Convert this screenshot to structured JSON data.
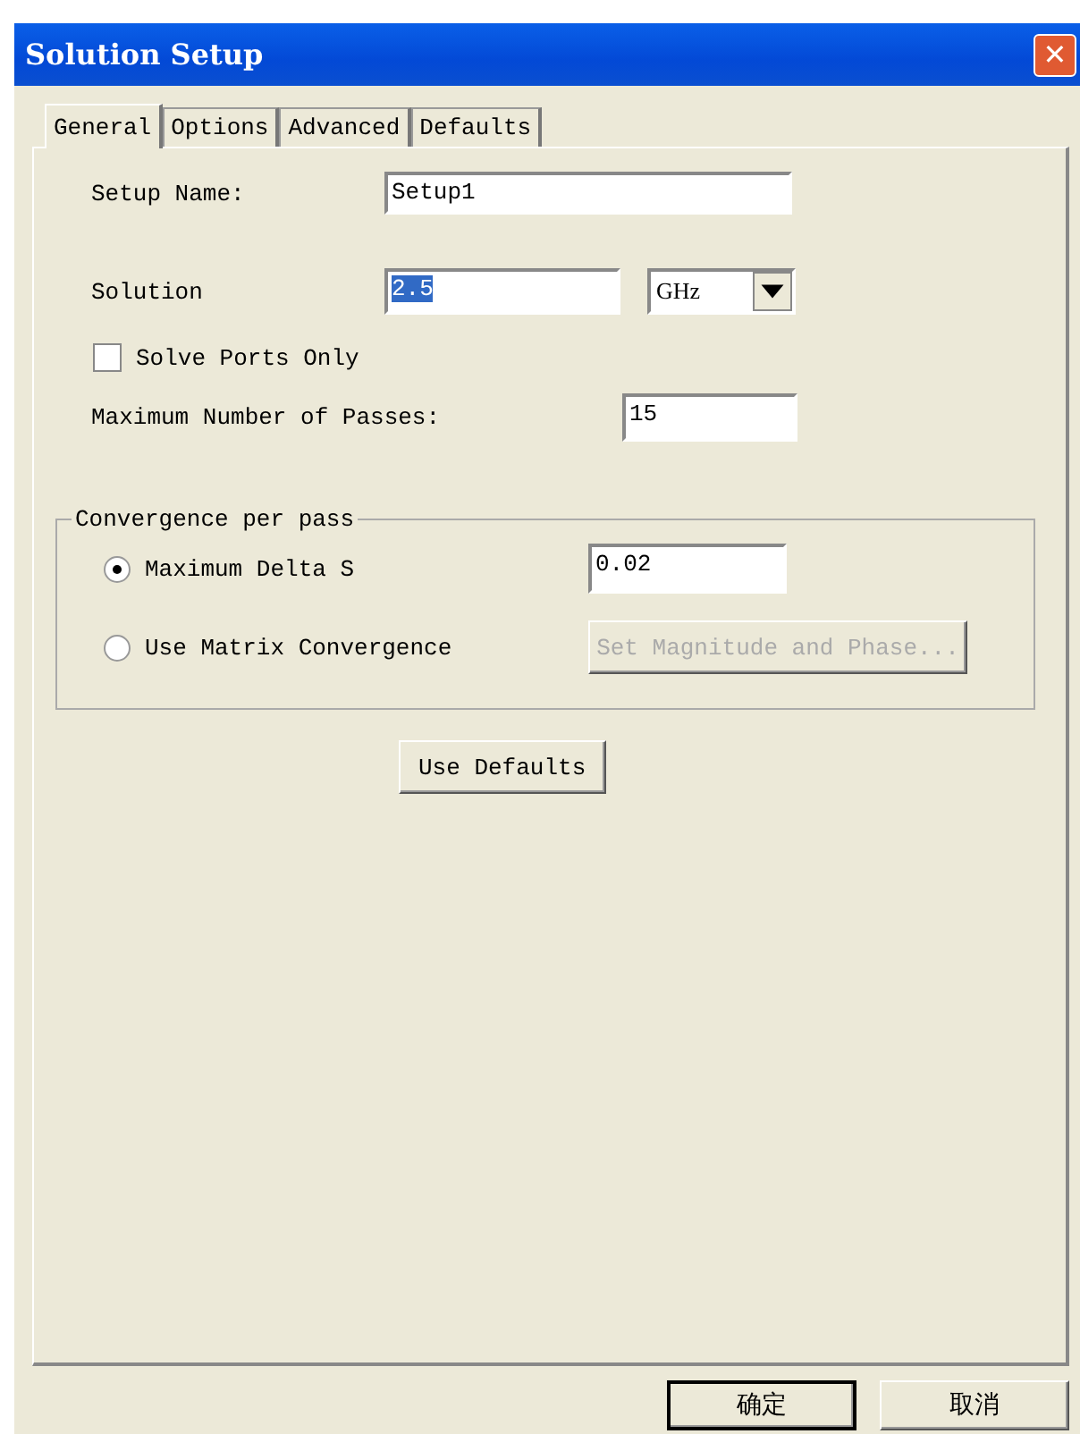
{
  "window": {
    "title": "Solution Setup",
    "close": "✕"
  },
  "tabs": [
    {
      "label": "General",
      "selected": true
    },
    {
      "label": "Options",
      "selected": false
    },
    {
      "label": "Advanced",
      "selected": false
    },
    {
      "label": "Defaults",
      "selected": false
    }
  ],
  "setup_name": {
    "label": "Setup Name:",
    "value": "Setup1"
  },
  "solution": {
    "label": "Solution",
    "value": "2.5",
    "value_selected": true,
    "unit": "GHz"
  },
  "solve_ports_only": {
    "label": "Solve Ports Only",
    "checked": false
  },
  "max_passes": {
    "label": "Maximum Number of Passes:",
    "value": "15"
  },
  "convergence": {
    "title": "Convergence per pass",
    "options": [
      {
        "label": "Maximum Delta S",
        "selected": true,
        "kind": "field",
        "value": "0.02"
      },
      {
        "label": "Use Matrix Convergence",
        "selected": false,
        "kind": "button",
        "button": "Set Magnitude and Phase...",
        "disabled": true
      }
    ]
  },
  "use_defaults": "Use Defaults",
  "buttons": [
    {
      "label": "确定",
      "default": true
    },
    {
      "label": "取消",
      "default": false
    }
  ]
}
